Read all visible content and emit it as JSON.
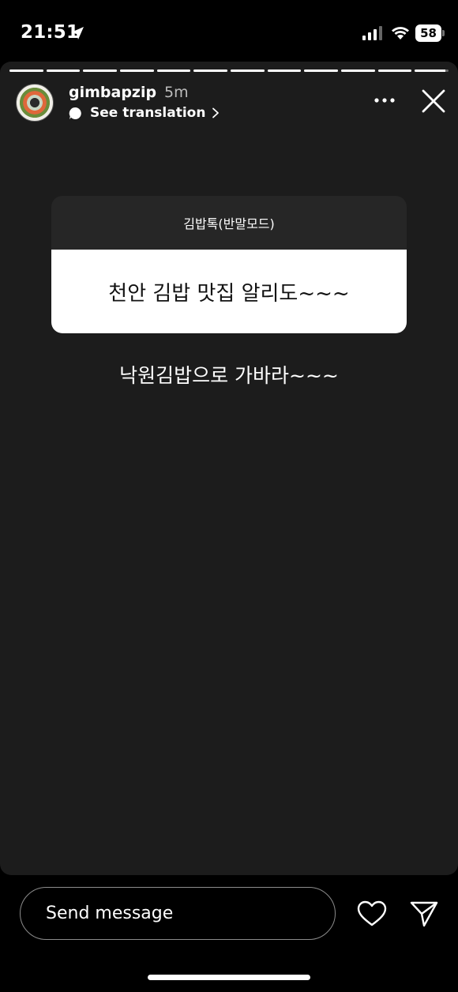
{
  "status_bar": {
    "time": "21:51",
    "battery_level": "58",
    "icons": [
      "location-arrow-icon",
      "cellular-signal-icon",
      "wifi-icon",
      "battery-icon"
    ]
  },
  "story": {
    "segments_total": 12,
    "segments_completed": 11,
    "current_progress": 0.9,
    "username": "gimbapzip",
    "time_ago": "5m",
    "translation_label": "See translation",
    "card": {
      "header": "김밥톡(반말모드)",
      "question": "천안 김밥 맛집 알리도~~~"
    },
    "caption": "낙원김밥으로 가바라~~~"
  },
  "footer": {
    "message_placeholder": "Send message"
  },
  "colors": {
    "story_background": "#1c1c1c",
    "screen_background": "#000000",
    "card_header": "#262626",
    "card_body": "#ffffff"
  }
}
